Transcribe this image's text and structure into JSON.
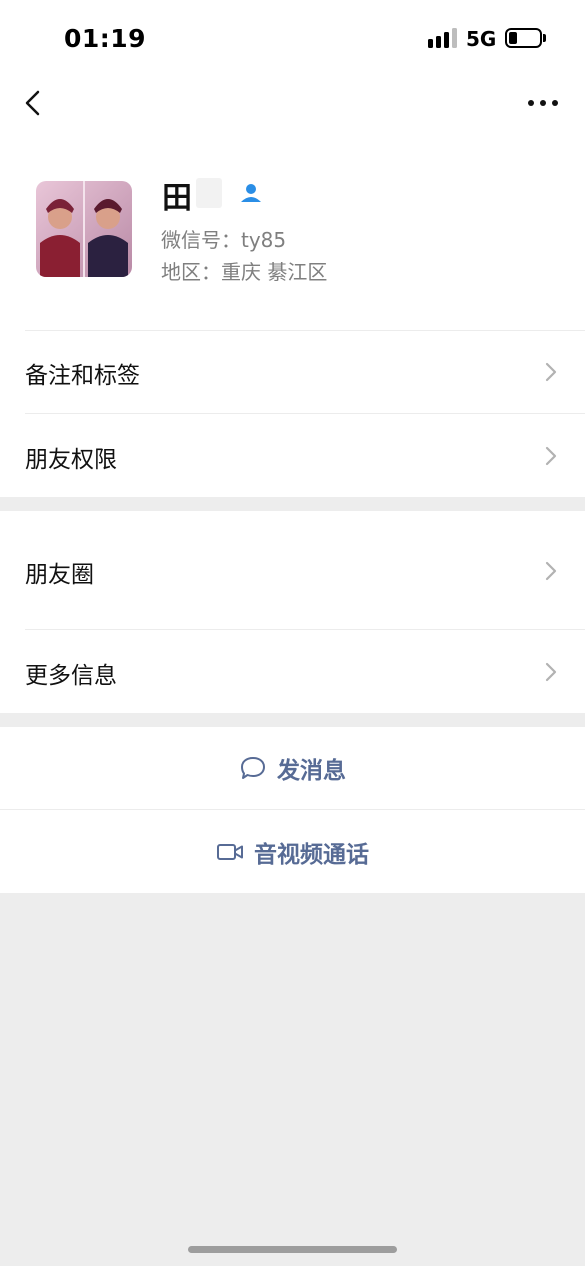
{
  "status": {
    "time": "01:19",
    "network": "5G"
  },
  "nav": {
    "back_icon": "chevron-left-icon",
    "more_icon": "more-dots-icon"
  },
  "profile": {
    "name": "田",
    "wechat_id": "微信号：ty85",
    "region": "地区：重庆 綦江区"
  },
  "rows": {
    "remark_tags": "备注和标签",
    "friend_permissions": "朋友权限",
    "moments": "朋友圈",
    "more_info": "更多信息"
  },
  "actions": {
    "message": "发消息",
    "video_call": "音视频通话"
  },
  "colors": {
    "link": "#576b95",
    "background": "#ededed",
    "verified": "#2a8ee6"
  }
}
